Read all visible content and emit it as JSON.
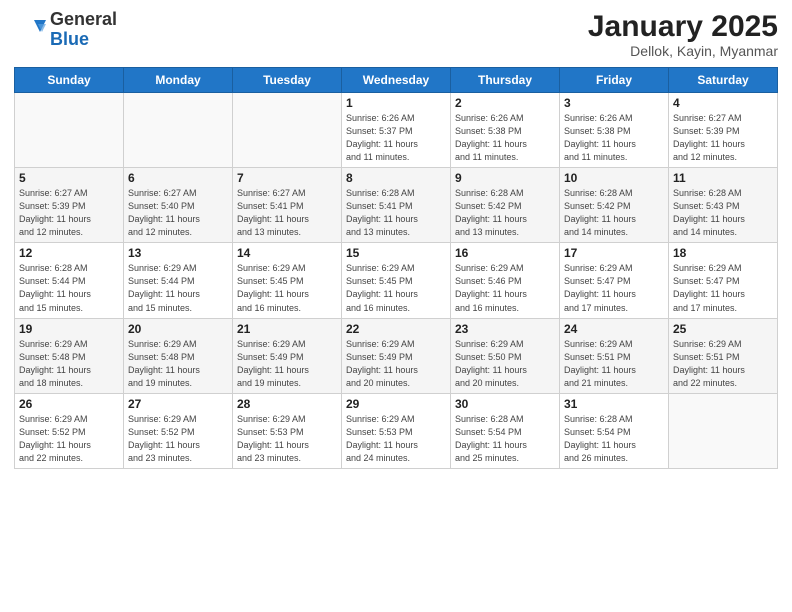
{
  "logo": {
    "general": "General",
    "blue": "Blue"
  },
  "header": {
    "title": "January 2025",
    "subtitle": "Dellok, Kayin, Myanmar"
  },
  "weekdays": [
    "Sunday",
    "Monday",
    "Tuesday",
    "Wednesday",
    "Thursday",
    "Friday",
    "Saturday"
  ],
  "weeks": [
    [
      {
        "day": "",
        "info": ""
      },
      {
        "day": "",
        "info": ""
      },
      {
        "day": "",
        "info": ""
      },
      {
        "day": "1",
        "info": "Sunrise: 6:26 AM\nSunset: 5:37 PM\nDaylight: 11 hours\nand 11 minutes."
      },
      {
        "day": "2",
        "info": "Sunrise: 6:26 AM\nSunset: 5:38 PM\nDaylight: 11 hours\nand 11 minutes."
      },
      {
        "day": "3",
        "info": "Sunrise: 6:26 AM\nSunset: 5:38 PM\nDaylight: 11 hours\nand 11 minutes."
      },
      {
        "day": "4",
        "info": "Sunrise: 6:27 AM\nSunset: 5:39 PM\nDaylight: 11 hours\nand 12 minutes."
      }
    ],
    [
      {
        "day": "5",
        "info": "Sunrise: 6:27 AM\nSunset: 5:39 PM\nDaylight: 11 hours\nand 12 minutes."
      },
      {
        "day": "6",
        "info": "Sunrise: 6:27 AM\nSunset: 5:40 PM\nDaylight: 11 hours\nand 12 minutes."
      },
      {
        "day": "7",
        "info": "Sunrise: 6:27 AM\nSunset: 5:41 PM\nDaylight: 11 hours\nand 13 minutes."
      },
      {
        "day": "8",
        "info": "Sunrise: 6:28 AM\nSunset: 5:41 PM\nDaylight: 11 hours\nand 13 minutes."
      },
      {
        "day": "9",
        "info": "Sunrise: 6:28 AM\nSunset: 5:42 PM\nDaylight: 11 hours\nand 13 minutes."
      },
      {
        "day": "10",
        "info": "Sunrise: 6:28 AM\nSunset: 5:42 PM\nDaylight: 11 hours\nand 14 minutes."
      },
      {
        "day": "11",
        "info": "Sunrise: 6:28 AM\nSunset: 5:43 PM\nDaylight: 11 hours\nand 14 minutes."
      }
    ],
    [
      {
        "day": "12",
        "info": "Sunrise: 6:28 AM\nSunset: 5:44 PM\nDaylight: 11 hours\nand 15 minutes."
      },
      {
        "day": "13",
        "info": "Sunrise: 6:29 AM\nSunset: 5:44 PM\nDaylight: 11 hours\nand 15 minutes."
      },
      {
        "day": "14",
        "info": "Sunrise: 6:29 AM\nSunset: 5:45 PM\nDaylight: 11 hours\nand 16 minutes."
      },
      {
        "day": "15",
        "info": "Sunrise: 6:29 AM\nSunset: 5:45 PM\nDaylight: 11 hours\nand 16 minutes."
      },
      {
        "day": "16",
        "info": "Sunrise: 6:29 AM\nSunset: 5:46 PM\nDaylight: 11 hours\nand 16 minutes."
      },
      {
        "day": "17",
        "info": "Sunrise: 6:29 AM\nSunset: 5:47 PM\nDaylight: 11 hours\nand 17 minutes."
      },
      {
        "day": "18",
        "info": "Sunrise: 6:29 AM\nSunset: 5:47 PM\nDaylight: 11 hours\nand 17 minutes."
      }
    ],
    [
      {
        "day": "19",
        "info": "Sunrise: 6:29 AM\nSunset: 5:48 PM\nDaylight: 11 hours\nand 18 minutes."
      },
      {
        "day": "20",
        "info": "Sunrise: 6:29 AM\nSunset: 5:48 PM\nDaylight: 11 hours\nand 19 minutes."
      },
      {
        "day": "21",
        "info": "Sunrise: 6:29 AM\nSunset: 5:49 PM\nDaylight: 11 hours\nand 19 minutes."
      },
      {
        "day": "22",
        "info": "Sunrise: 6:29 AM\nSunset: 5:49 PM\nDaylight: 11 hours\nand 20 minutes."
      },
      {
        "day": "23",
        "info": "Sunrise: 6:29 AM\nSunset: 5:50 PM\nDaylight: 11 hours\nand 20 minutes."
      },
      {
        "day": "24",
        "info": "Sunrise: 6:29 AM\nSunset: 5:51 PM\nDaylight: 11 hours\nand 21 minutes."
      },
      {
        "day": "25",
        "info": "Sunrise: 6:29 AM\nSunset: 5:51 PM\nDaylight: 11 hours\nand 22 minutes."
      }
    ],
    [
      {
        "day": "26",
        "info": "Sunrise: 6:29 AM\nSunset: 5:52 PM\nDaylight: 11 hours\nand 22 minutes."
      },
      {
        "day": "27",
        "info": "Sunrise: 6:29 AM\nSunset: 5:52 PM\nDaylight: 11 hours\nand 23 minutes."
      },
      {
        "day": "28",
        "info": "Sunrise: 6:29 AM\nSunset: 5:53 PM\nDaylight: 11 hours\nand 23 minutes."
      },
      {
        "day": "29",
        "info": "Sunrise: 6:29 AM\nSunset: 5:53 PM\nDaylight: 11 hours\nand 24 minutes."
      },
      {
        "day": "30",
        "info": "Sunrise: 6:28 AM\nSunset: 5:54 PM\nDaylight: 11 hours\nand 25 minutes."
      },
      {
        "day": "31",
        "info": "Sunrise: 6:28 AM\nSunset: 5:54 PM\nDaylight: 11 hours\nand 26 minutes."
      },
      {
        "day": "",
        "info": ""
      }
    ]
  ]
}
